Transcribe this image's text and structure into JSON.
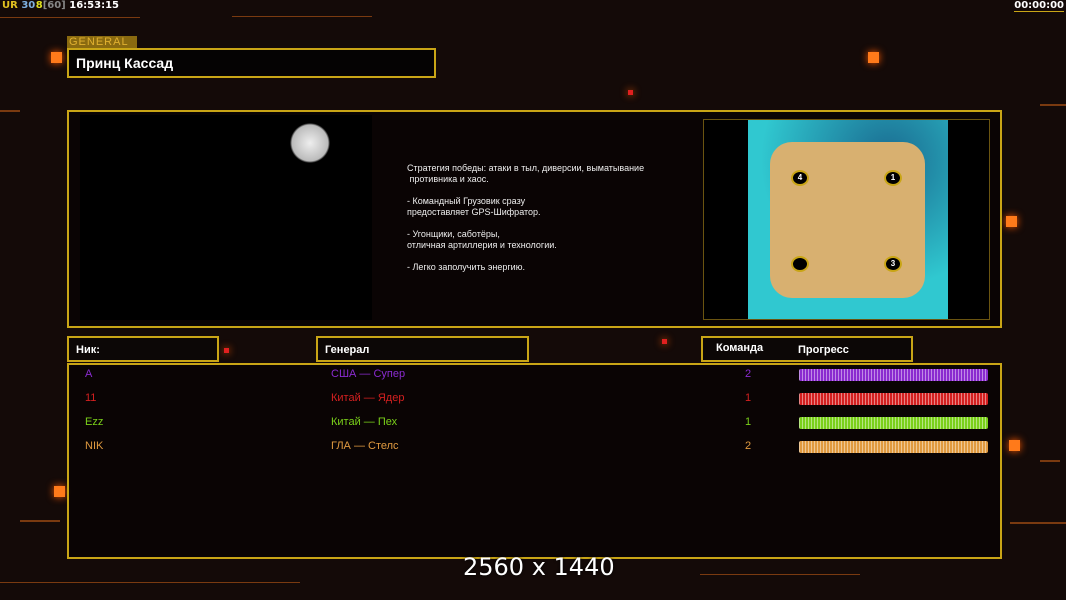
{
  "hud": {
    "ur": "UR",
    "fps": "30",
    "num": "8",
    "bracket": "[60]",
    "clock": "16:53:15",
    "timer": "00:00:00"
  },
  "general_tag": "GENERAL",
  "general_name": "Принц Кассад",
  "description": [
    "Стратегия победы: атаки в тыл, диверсии, выматывание",
    " противника и хаос.",
    "",
    "- Командный Грузовик сразу",
    "предоставляет GPS-Шифратор.",
    "",
    "- Угонщики, саботёры,",
    "отличная артиллерия и технологии.",
    "",
    "- Легко заполучить энергию."
  ],
  "map_markers": [
    "4",
    "1",
    "",
    "3"
  ],
  "headers": {
    "nick": "Ник:",
    "general": "Генерал",
    "team": "Команда",
    "progress": "Прогресс"
  },
  "players": [
    {
      "nick": "A",
      "general": "США — Супер",
      "team": "2",
      "progress": 1.0,
      "color": "#8a2bd0"
    },
    {
      "nick": "11",
      "general": "Китай — Ядер",
      "team": "1",
      "progress": 1.0,
      "color": "#d42020"
    },
    {
      "nick": "Ezz",
      "general": "Китай — Пех",
      "team": "1",
      "progress": 1.0,
      "color": "#7ad01a"
    },
    {
      "nick": "NIK",
      "general": "ГЛА — Стелс",
      "team": "2",
      "progress": 1.0,
      "color": "#e09a40"
    }
  ],
  "watermark": "2560 x 1440"
}
